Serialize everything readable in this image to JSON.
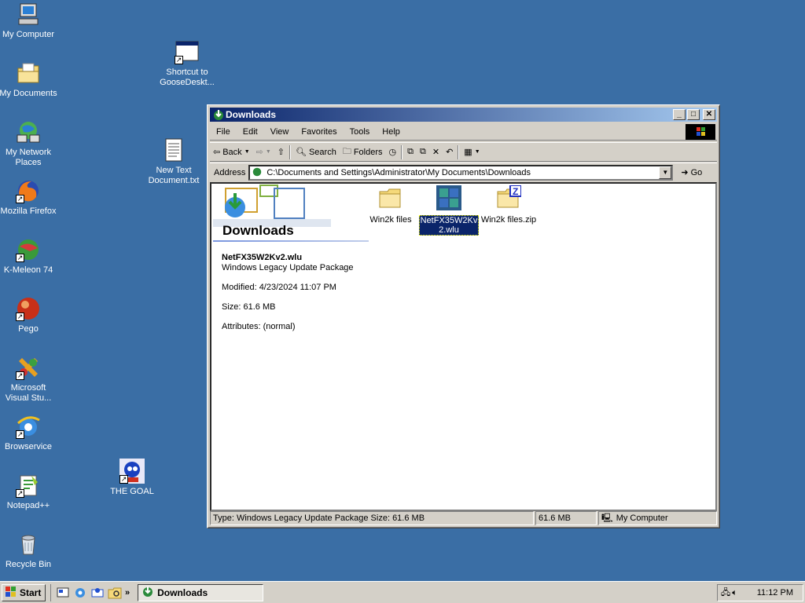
{
  "desktop": {
    "icons": [
      {
        "label": "My Computer"
      },
      {
        "label": "My Documents"
      },
      {
        "label": "My Network Places"
      },
      {
        "label": "Mozilla Firefox"
      },
      {
        "label": "K-Meleon 74"
      },
      {
        "label": "Pego"
      },
      {
        "label": "Microsoft Visual Stu..."
      },
      {
        "label": "Browservice"
      },
      {
        "label": "Notepad++"
      },
      {
        "label": "Recycle Bin"
      },
      {
        "label": "Shortcut to GooseDeskt..."
      },
      {
        "label": "New Text Document.txt"
      },
      {
        "label": "THE GOAL"
      }
    ]
  },
  "window": {
    "title": "Downloads",
    "menu": [
      "File",
      "Edit",
      "View",
      "Favorites",
      "Tools",
      "Help"
    ],
    "toolbar": {
      "back": "Back",
      "search": "Search",
      "folders": "Folders"
    },
    "address": {
      "label": "Address",
      "value": "C:\\Documents and Settings\\Administrator\\My Documents\\Downloads",
      "go": "Go"
    },
    "left_panel": {
      "heading": "Downloads",
      "file_name": "NetFX35W2Kv2.wlu",
      "file_type": "Windows Legacy Update Package",
      "modified": "Modified: 4/23/2024 11:07 PM",
      "size": "Size: 61.6 MB",
      "attributes": "Attributes: (normal)"
    },
    "files": [
      {
        "name": "Win2k files",
        "type": "folder",
        "selected": false
      },
      {
        "name": "NetFX35W2Kv2.wlu",
        "type": "wlu",
        "selected": true
      },
      {
        "name": "Win2k files.zip",
        "type": "zip",
        "selected": false
      }
    ],
    "status": {
      "text": "Type: Windows Legacy Update Package Size: 61.6 MB",
      "size": "61.6 MB",
      "zone": "My Computer"
    }
  },
  "taskbar": {
    "start": "Start",
    "task": "Downloads",
    "clock": "11:12 PM"
  },
  "colors": {
    "desktop": "#3a6ea5",
    "titlebar": "#0a246a",
    "selection": "#0a246a",
    "face": "#d4d0c8"
  }
}
